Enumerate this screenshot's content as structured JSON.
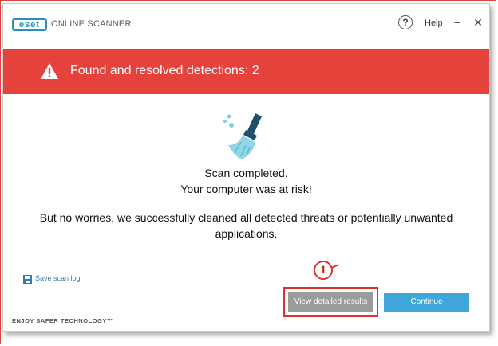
{
  "header": {
    "logo_text": "eset",
    "product_name": "ONLINE SCANNER",
    "help_label": "Help",
    "help_icon_text": "?",
    "minimize_text": "–",
    "close_text": "✕"
  },
  "banner": {
    "text": "Found and resolved detections: 2",
    "color": "#e4423b",
    "icon": "warning-triangle-icon"
  },
  "main": {
    "icon": "broom-icon",
    "line1": "Scan completed.",
    "line2": "Your computer was at risk!",
    "line3": "But no worries, we successfully cleaned all detected threats or potentially unwanted applications."
  },
  "footer": {
    "save_log_label": "Save scan log",
    "tagline": "ENJOY SAFER TECHNOLOGY™",
    "details_button": "View detailed results",
    "continue_button": "Continue",
    "callout_number": "1",
    "accent_color": "#3ea6d9",
    "callout_color": "#e0302a"
  }
}
